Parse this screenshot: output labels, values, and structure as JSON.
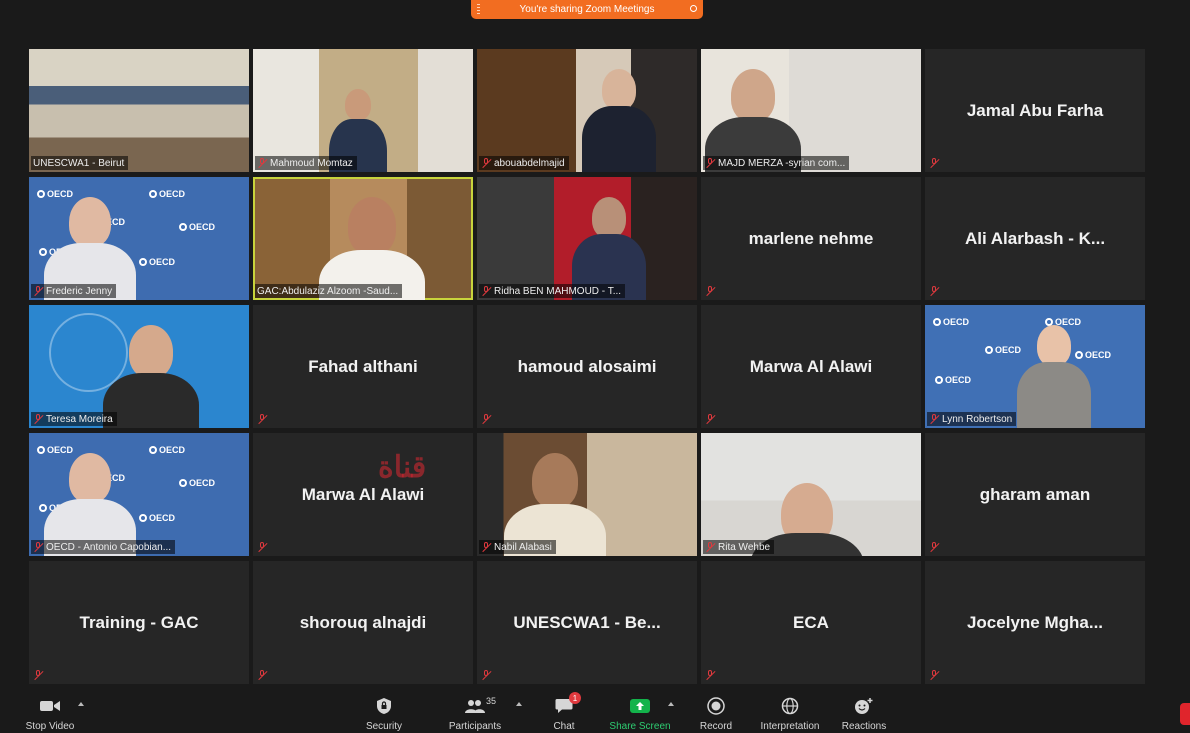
{
  "banner": {
    "text": "You're sharing Zoom Meetings"
  },
  "colors": {
    "banner": "#f26d21",
    "active_speaker": "#c8d43c",
    "muted_red": "#e0393e",
    "share_green": "#13b34b"
  },
  "tiles": [
    {
      "kind": "video",
      "label": "UNESCWA1 - Beirut",
      "bg": "v-unescwa",
      "muted": false
    },
    {
      "kind": "video",
      "label": "Mahmoud Momtaz",
      "bg": "v-momtaz",
      "muted": true
    },
    {
      "kind": "video",
      "label": "abouabdelmajid",
      "bg": "v-abou",
      "muted": true
    },
    {
      "kind": "video",
      "label": "MAJD MERZA -syrian com...",
      "bg": "v-majd",
      "muted": true
    },
    {
      "kind": "name",
      "label": "Jamal Abu Farha",
      "muted": true
    },
    {
      "kind": "video",
      "label": "Frederic Jenny",
      "bg": "v-oecd",
      "muted": true
    },
    {
      "kind": "video",
      "label": "GAC:Abdulaziz Alzoom -Saud...",
      "bg": "v-gac",
      "muted": false,
      "active": true
    },
    {
      "kind": "video",
      "label": "Ridha BEN MAHMOUD - T...",
      "bg": "v-ridha",
      "muted": true
    },
    {
      "kind": "name",
      "label": "marlene nehme",
      "muted": true
    },
    {
      "kind": "name",
      "label": "Ali Alarbash - K...",
      "muted": true
    },
    {
      "kind": "video",
      "label": "Teresa Moreira",
      "bg": "v-teresa",
      "muted": true
    },
    {
      "kind": "name",
      "label": "Fahad althani",
      "muted": true
    },
    {
      "kind": "name",
      "label": "hamoud alosaimi",
      "muted": true
    },
    {
      "kind": "name",
      "label": "Marwa Al Alawi",
      "muted": true
    },
    {
      "kind": "video",
      "label": "Lynn Robertson",
      "bg": "v-oecd2",
      "muted": true
    },
    {
      "kind": "video",
      "label": "OECD - Antonio Capobian...",
      "bg": "v-oecd",
      "muted": true
    },
    {
      "kind": "name",
      "label": "Marwa Al Alawi",
      "muted": true
    },
    {
      "kind": "video",
      "label": "Nabil Alabasi",
      "bg": "v-nabil",
      "muted": true
    },
    {
      "kind": "video",
      "label": "Rita Wehbe",
      "bg": "v-rita",
      "muted": true
    },
    {
      "kind": "name",
      "label": "gharam aman",
      "muted": true
    },
    {
      "kind": "name",
      "label": "Training - GAC",
      "muted": true
    },
    {
      "kind": "name",
      "label": "shorouq alnajdi",
      "muted": true
    },
    {
      "kind": "name",
      "label": "UNESCWA1 - Be...",
      "muted": true
    },
    {
      "kind": "name",
      "label": "ECA",
      "muted": true
    },
    {
      "kind": "name",
      "label": "Jocelyne  Mgha...",
      "muted": true
    }
  ],
  "toolbar": {
    "stop_video": "Stop Video",
    "security": "Security",
    "participants": "Participants",
    "participants_count": "35",
    "chat": "Chat",
    "chat_badge": "1",
    "share_screen": "Share Screen",
    "record": "Record",
    "interpretation": "Interpretation",
    "reactions": "Reactions"
  }
}
